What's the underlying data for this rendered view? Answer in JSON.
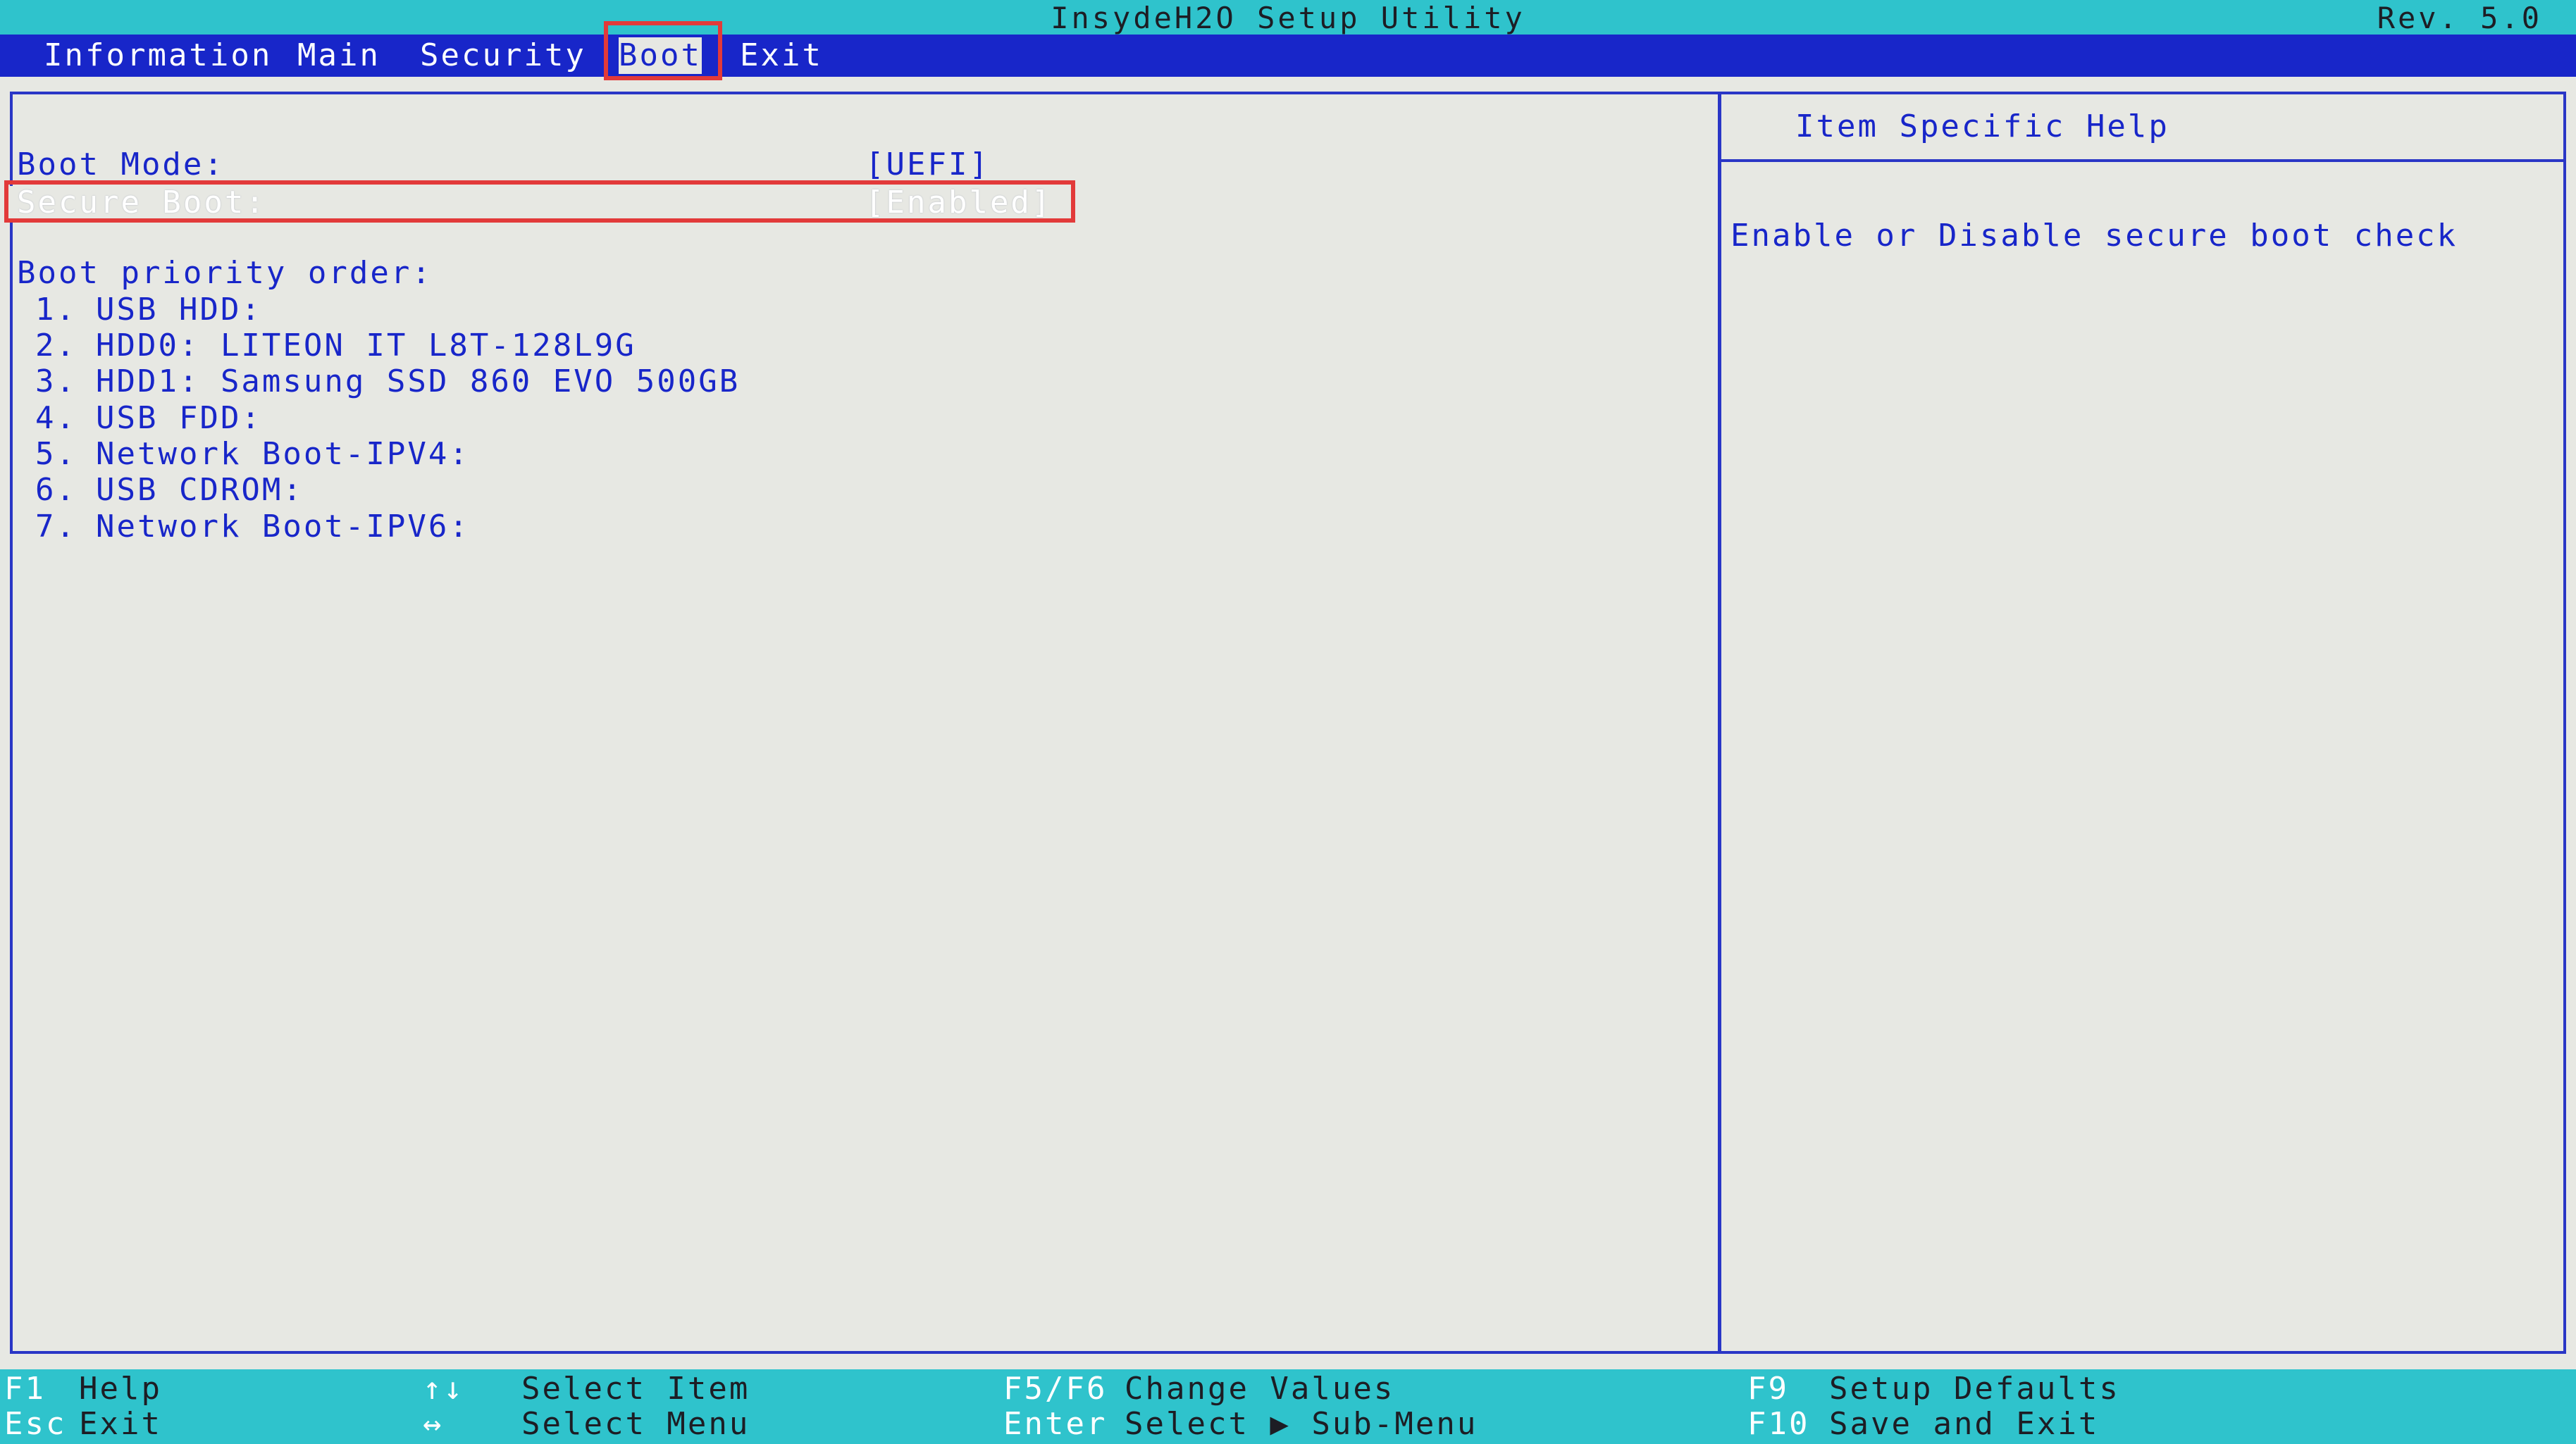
{
  "window": {
    "title": "InsydeH2O Setup Utility",
    "revision": "Rev. 5.0"
  },
  "menu": {
    "tabs": [
      "Information",
      "Main",
      "Security",
      "Boot",
      "Exit"
    ],
    "active": "Boot"
  },
  "settings": {
    "boot_mode_label": "Boot Mode:",
    "boot_mode_value": "[UEFI]",
    "secure_boot_label": "Secure Boot:",
    "secure_boot_value": "[Enabled]",
    "boot_priority_label": "Boot priority order:"
  },
  "boot_order": [
    {
      "num": "1.",
      "name": "USB HDD:"
    },
    {
      "num": "2.",
      "name": "HDD0: LITEON IT L8T-128L9G"
    },
    {
      "num": "3.",
      "name": "HDD1: Samsung SSD 860 EVO 500GB"
    },
    {
      "num": "4.",
      "name": "USB FDD:"
    },
    {
      "num": "5.",
      "name": "Network Boot-IPV4:"
    },
    {
      "num": "6.",
      "name": "USB CDROM:"
    },
    {
      "num": "7.",
      "name": "Network Boot-IPV6:"
    }
  ],
  "help_panel": {
    "title": "Item Specific Help",
    "text": "Enable or Disable secure boot check"
  },
  "footer": {
    "f1_key": "F1",
    "f1_desc": "Help",
    "esc_key": "Esc",
    "esc_desc": "Exit",
    "updown_key": "↑↓",
    "updown_desc": "Select Item",
    "leftright_key": "↔",
    "leftright_desc": "Select Menu",
    "f5f6_key": "F5/F6",
    "f5f6_desc": "Change Values",
    "enter_key": "Enter",
    "enter_desc": "Select ▶ Sub-Menu",
    "f9_key": "F9",
    "f9_desc": "Setup Defaults",
    "f10_key": "F10",
    "f10_desc": "Save and Exit"
  },
  "colors": {
    "title_bar": "#2fc3cc",
    "menu_bar": "#1826c9",
    "text_blue": "#1826c9",
    "background": "#e7e8e3",
    "highlight_red": "#e23a3a"
  }
}
